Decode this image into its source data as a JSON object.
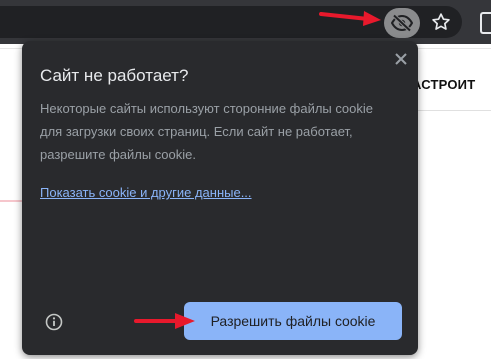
{
  "toolbar": {
    "eye_icon": "eye-slash-icon",
    "star_icon": "star-outline-icon"
  },
  "page": {
    "nav_text": "АСТРОИТ"
  },
  "popup": {
    "title": "Сайт не работает?",
    "description": "Некоторые сайты используют сторонние файлы cookie для загрузки своих страниц. Если сайт не работает, разрешите файлы cookie.",
    "link": "Показать cookie и другие данные...",
    "allow_button": "Разрешить файлы cookie",
    "close_icon": "close-icon",
    "info_icon": "info-icon"
  },
  "colors": {
    "popup_bg": "#292a2d",
    "button_bg": "#8ab4f8",
    "link": "#8ab4f8",
    "annotation_arrow": "#e8192c"
  }
}
